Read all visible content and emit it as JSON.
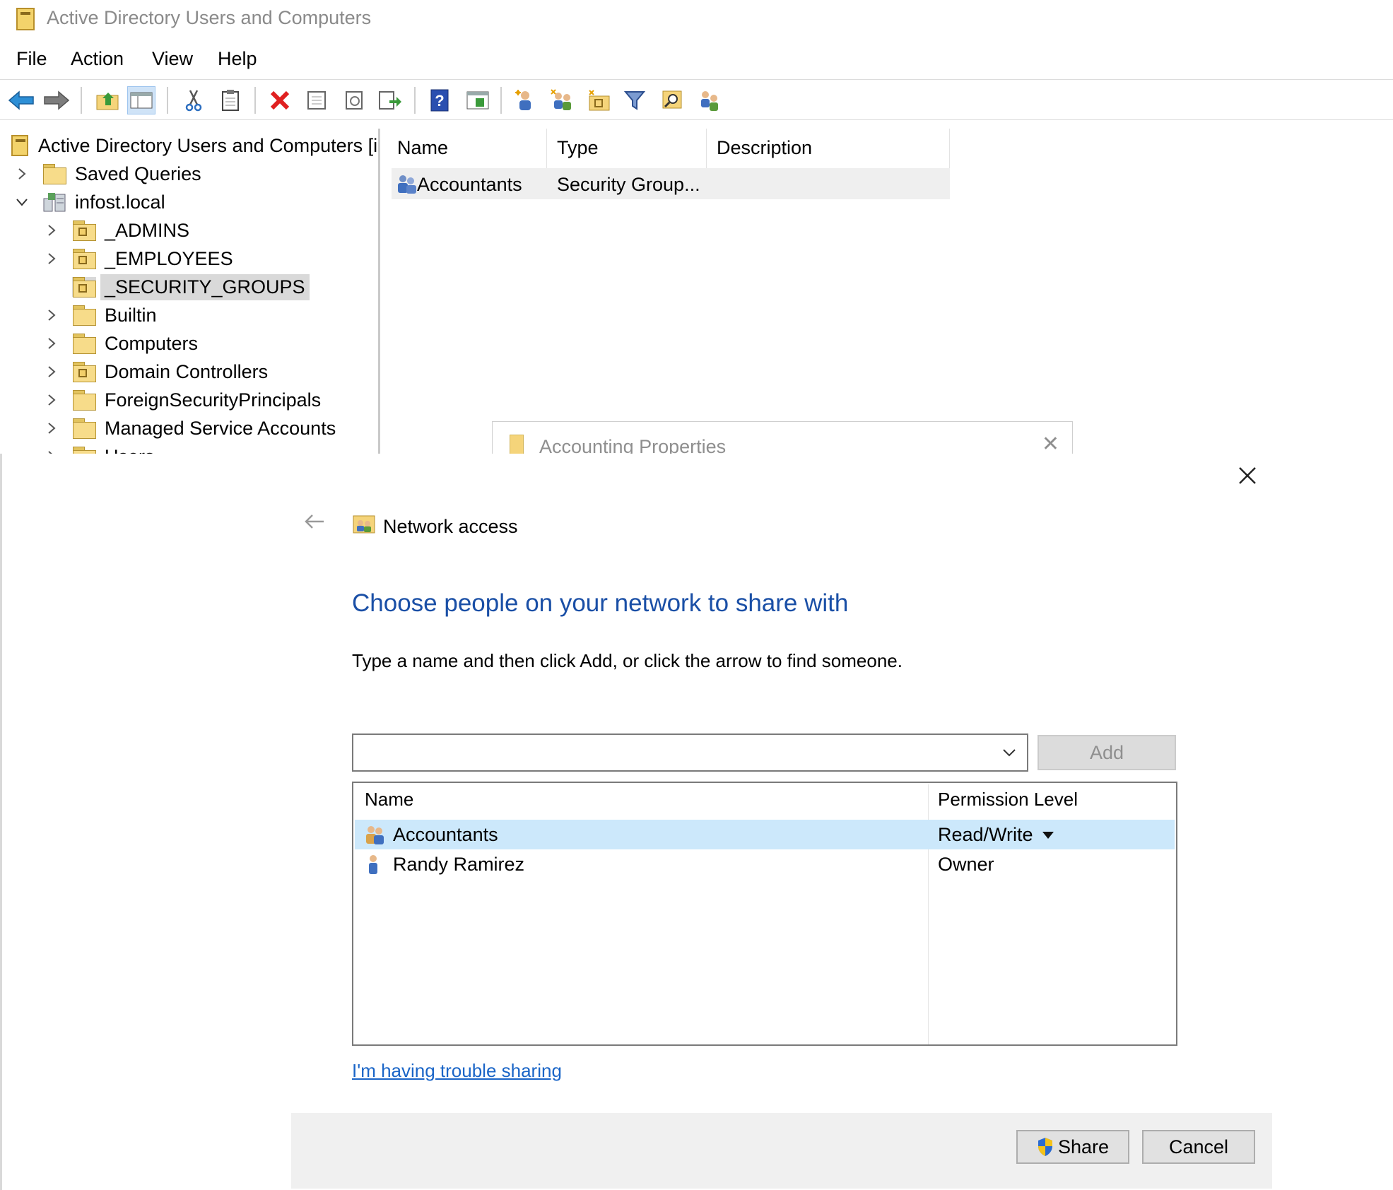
{
  "window": {
    "title": "Active Directory Users and Computers"
  },
  "menu": {
    "file": "File",
    "action": "Action",
    "view": "View",
    "help": "Help"
  },
  "toolbar": {
    "icons": [
      "back-icon",
      "forward-icon",
      "up-folder-icon",
      "show-hide-tree-icon",
      "cut-icon",
      "paste-icon",
      "delete-icon",
      "properties-icon",
      "refresh-icon",
      "export-list-icon",
      "help-icon",
      "console-view-icon",
      "new-user-icon",
      "new-group-icon",
      "new-ou-icon",
      "filter-icon",
      "find-icon",
      "add-to-group-icon"
    ]
  },
  "tree": {
    "root": "Active Directory Users and Computers [i",
    "saved_queries": "Saved Queries",
    "domain": "infost.local",
    "items": [
      "_ADMINS",
      "_EMPLOYEES",
      "_SECURITY_GROUPS",
      "Builtin",
      "Computers",
      "Domain Controllers",
      "ForeignSecurityPrincipals",
      "Managed Service Accounts",
      "Users"
    ],
    "selected": "_SECURITY_GROUPS"
  },
  "list": {
    "columns": {
      "name": "Name",
      "type": "Type",
      "description": "Description"
    },
    "rows": [
      {
        "name": "Accountants",
        "type": "Security Group...",
        "description": ""
      }
    ]
  },
  "background_dialog": {
    "title": "Accounting Properties"
  },
  "share": {
    "header_title": "Network access",
    "heading": "Choose people on your network to share with",
    "instruction": "Type a name and then click Add, or click the arrow to find someone.",
    "name_input_value": "",
    "add_label": "Add",
    "columns": {
      "name": "Name",
      "permission": "Permission Level"
    },
    "people": [
      {
        "name": "Accountants",
        "permission": "Read/Write"
      },
      {
        "name": "Randy Ramirez",
        "permission": "Owner"
      }
    ],
    "trouble_link": "I'm having trouble sharing",
    "share_label": "Share",
    "cancel_label": "Cancel"
  },
  "colors": {
    "heading_blue": "#1a4fa6",
    "link_blue": "#1a65c7",
    "selection": "#cce8fb"
  }
}
